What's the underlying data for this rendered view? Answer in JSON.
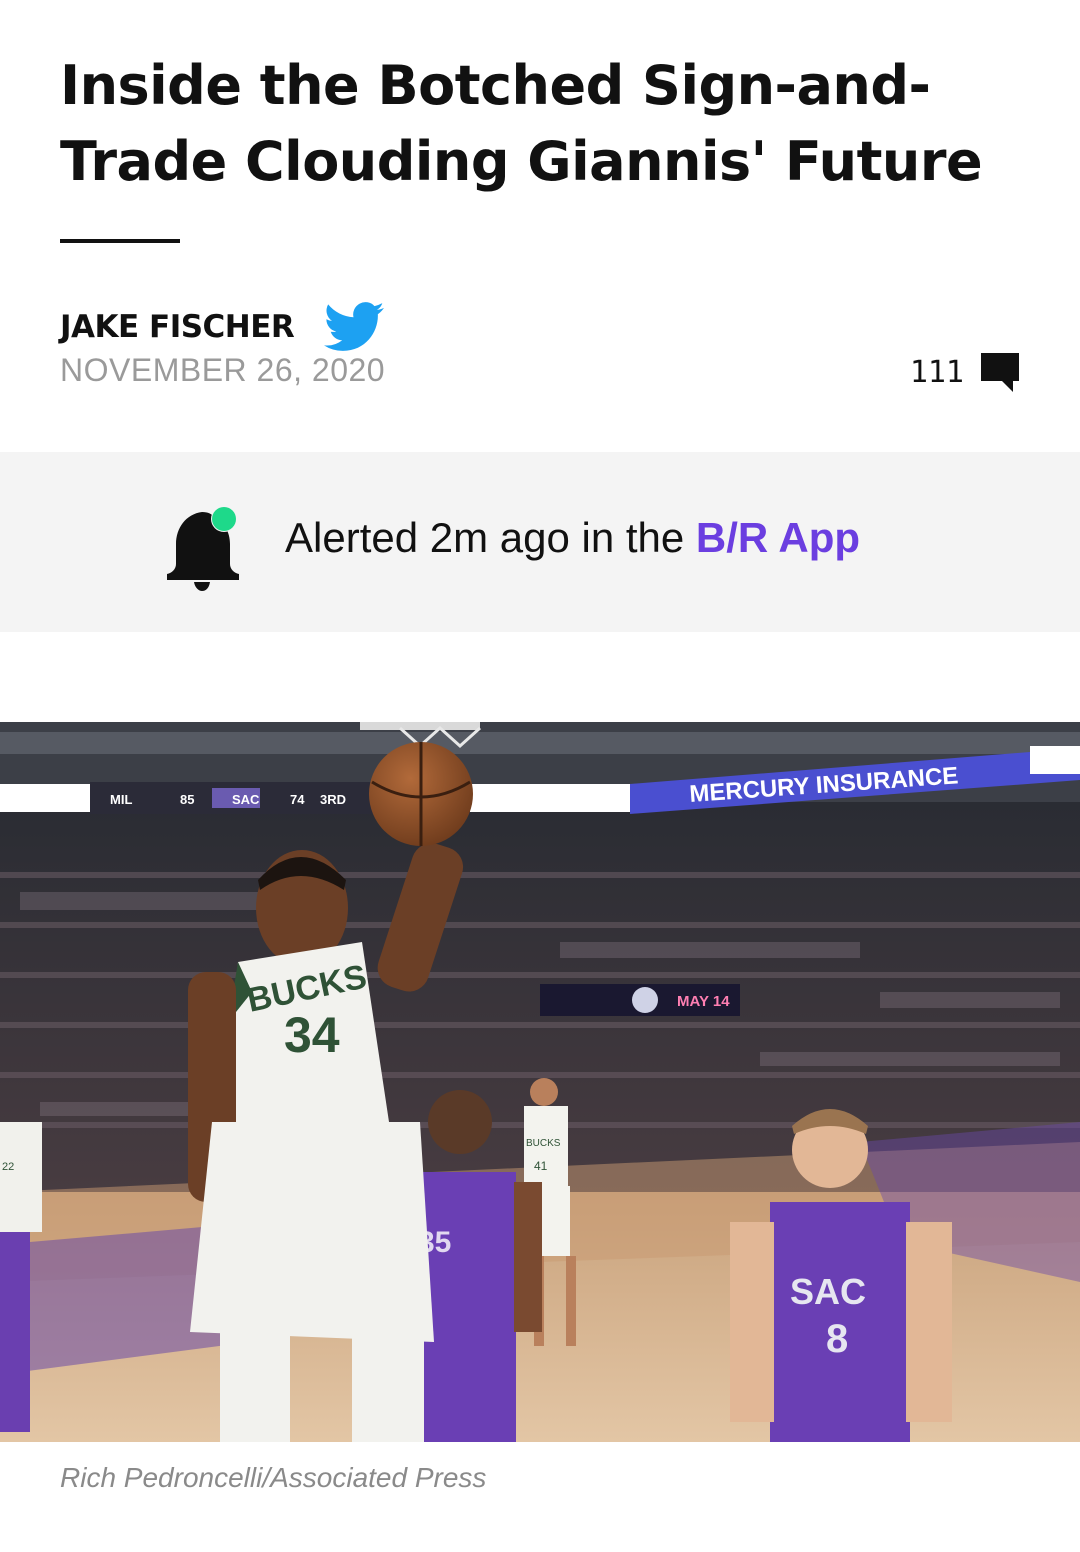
{
  "article": {
    "headline": "Inside the Botched Sign-and-Trade Clouding Giannis' Future",
    "author": "JAKE FISCHER",
    "date": "NOVEMBER 26, 2020",
    "comment_count": "111"
  },
  "alert": {
    "prefix": "Alerted 2m ago in the ",
    "app_name": "B/R App"
  },
  "photo": {
    "scoreboard": {
      "home": "MIL",
      "home_score": "85",
      "away": "SAC",
      "away_score": "74",
      "period": "3RD"
    },
    "ad_text": "MERCURY INSURANCE",
    "arena_sign": "MAY 14",
    "jerseys": {
      "main_team": "BUCKS",
      "main_number": "34",
      "bench_number": "22",
      "back_team": "BUCKS",
      "back_number": "41",
      "sac_team": "SAC",
      "sac_number": "8",
      "sac_center_number": "35"
    }
  },
  "caption": "Rich Pedroncelli/Associated Press",
  "colors": {
    "accent": "#6b3ee0",
    "alert_dot": "#1ed98a",
    "twitter": "#1da1f2",
    "bucks_green": "#2f5236",
    "kings_purple": "#5a2d9c"
  },
  "icons": {
    "twitter": "twitter-bird-icon",
    "comments": "comment-bubble-icon",
    "alert": "bell-icon"
  }
}
